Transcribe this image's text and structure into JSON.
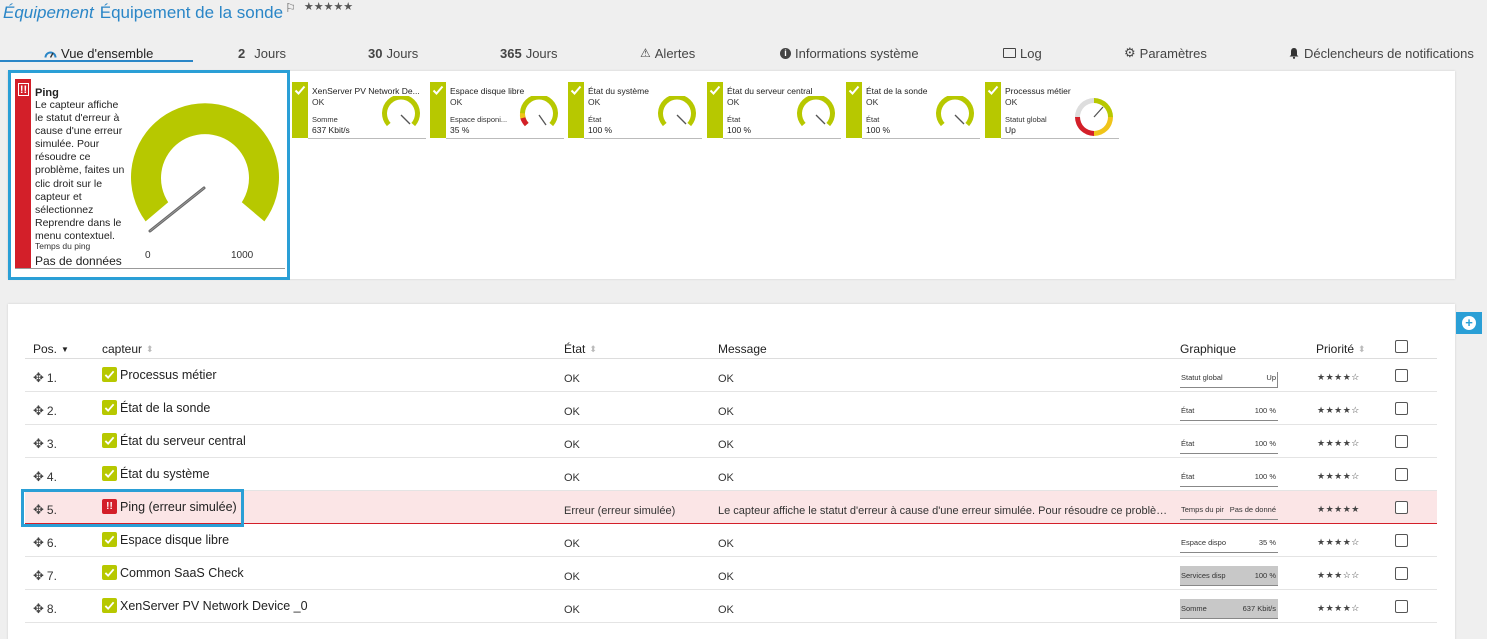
{
  "header": {
    "type_label": "Équipement",
    "device_name": "Équipement de la sonde",
    "flag_icon": "flag-icon",
    "stars": "★★★★★"
  },
  "tabs": [
    {
      "label": "Vue d'ensemble",
      "icon": "overview-gauge-icon",
      "active": true
    },
    {
      "num": "2",
      "label": "Jours"
    },
    {
      "num": "30",
      "label": "Jours"
    },
    {
      "num": "365",
      "label": "Jours"
    },
    {
      "label": "Alertes",
      "icon": "warning-icon"
    },
    {
      "label": "Informations système",
      "icon": "info-icon"
    },
    {
      "label": "Log",
      "icon": "log-icon"
    },
    {
      "label": "Paramètres",
      "icon": "gear-icon"
    },
    {
      "label": "Déclencheurs de notifications",
      "icon": "bell-icon"
    }
  ],
  "big_gauge": {
    "name": "Ping",
    "message": "Le capteur affiche le statut d'erreur à cause d'une erreur simulée. Pour résoudre ce problème, faites un clic droit sur le capteur et sélectionnez Reprendre dans le menu contextuel.",
    "channel": "Temps du ping",
    "value": "Pas de données",
    "min": "0",
    "max": "1000",
    "status_color": "#d31f29",
    "gauge_color": "#b7c800"
  },
  "small_gauges": [
    {
      "name": "XenServer PV Network De...",
      "status": "OK",
      "channel": "Somme",
      "value": "637 Kbit/s",
      "type": "plain"
    },
    {
      "name": "Espace disque libre",
      "status": "OK",
      "channel": "Espace disponi...",
      "value": "35 %",
      "type": "warn"
    },
    {
      "name": "État du système",
      "status": "OK",
      "channel": "État",
      "value": "100 %",
      "type": "plain"
    },
    {
      "name": "État du serveur central",
      "status": "OK",
      "channel": "État",
      "value": "100 %",
      "type": "plain"
    },
    {
      "name": "État de la sonde",
      "status": "OK",
      "channel": "État",
      "value": "100 %",
      "type": "plain"
    },
    {
      "name": "Processus métier",
      "status": "OK",
      "channel": "Statut global",
      "value": "Up",
      "type": "full"
    }
  ],
  "table": {
    "columns": {
      "pos": "Pos.",
      "sensor": "capteur",
      "state": "État",
      "message": "Message",
      "graph": "Graphique",
      "priority": "Priorité"
    },
    "rows": [
      {
        "pos": "1.",
        "name": "Processus métier",
        "state": "OK",
        "message": "OK",
        "mini_channel": "Statut global",
        "mini_value": "Up",
        "priority": "★★★★☆",
        "status": "ok"
      },
      {
        "pos": "2.",
        "name": "État de la sonde",
        "state": "OK",
        "message": "OK",
        "mini_channel": "État",
        "mini_value": "100 %",
        "priority": "★★★★☆",
        "status": "ok"
      },
      {
        "pos": "3.",
        "name": "État du serveur central",
        "state": "OK",
        "message": "OK",
        "mini_channel": "État",
        "mini_value": "100 %",
        "priority": "★★★★☆",
        "status": "ok"
      },
      {
        "pos": "4.",
        "name": "État du système",
        "state": "OK",
        "message": "OK",
        "mini_channel": "État",
        "mini_value": "100 %",
        "priority": "★★★★☆",
        "status": "ok"
      },
      {
        "pos": "5.",
        "name": "Ping (erreur simulée)",
        "state": "Erreur (erreur simulée)",
        "message": "Le capteur affiche le statut d'erreur à cause d'une erreur simulée. Pour résoudre ce problème, ...",
        "mini_channel": "Temps du pir",
        "mini_value": "Pas de donné",
        "priority": "★★★★★",
        "status": "error"
      },
      {
        "pos": "6.",
        "name": "Espace disque libre",
        "state": "OK",
        "message": "OK",
        "mini_channel": "Espace dispo",
        "mini_value": "35 %",
        "priority": "★★★★☆",
        "status": "ok"
      },
      {
        "pos": "7.",
        "name": "Common SaaS Check",
        "state": "OK",
        "message": "OK",
        "mini_channel": "Services disp",
        "mini_value": "100 %",
        "priority": "★★★☆☆",
        "status": "ok",
        "mini_filled": true
      },
      {
        "pos": "8.",
        "name": "XenServer PV Network Device _0",
        "state": "OK",
        "message": "OK",
        "mini_channel": "Somme",
        "mini_value": "637 Kbit/s",
        "priority": "★★★★☆",
        "status": "ok",
        "mini_filled": true
      }
    ]
  },
  "colors": {
    "accent": "#2a86c7",
    "ok": "#b7c800",
    "error": "#d31f29",
    "highlight": "#2a9fd6"
  }
}
